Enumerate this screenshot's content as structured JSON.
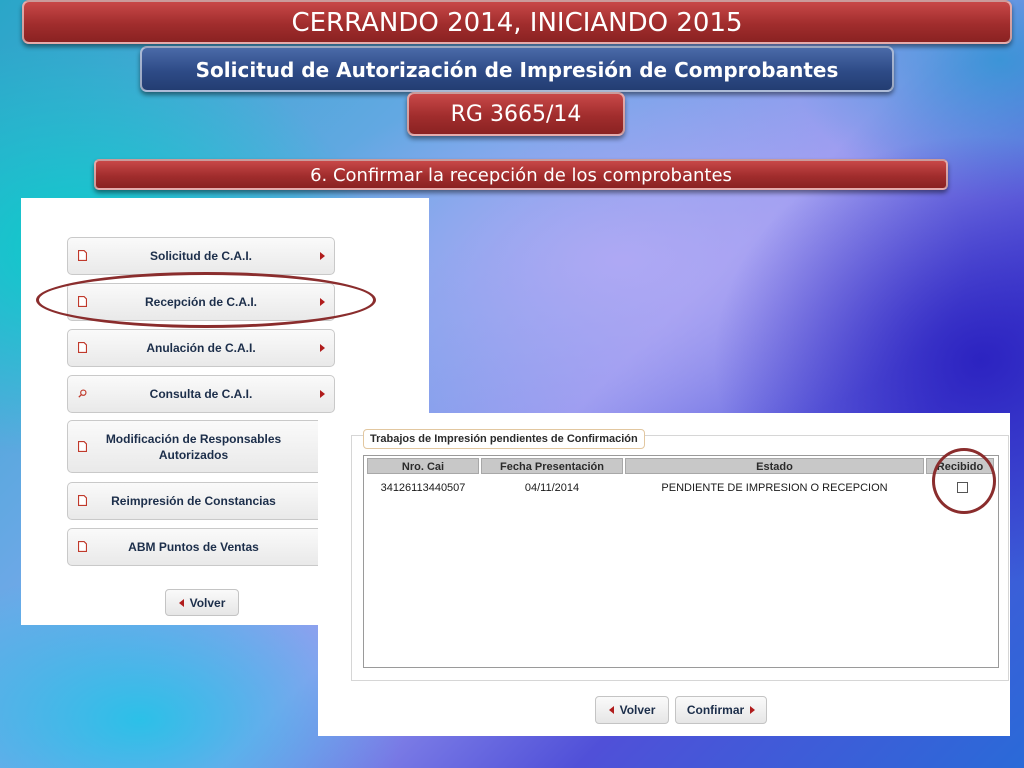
{
  "header": {
    "title": "CERRANDO 2014, INICIANDO 2015",
    "subtitle": "Solicitud de Autorización de Impresión de Comprobantes",
    "resolution": "RG 3665/14",
    "step": "6. Confirmar la recepción de los comprobantes"
  },
  "menu": {
    "items": [
      {
        "label": "Solicitud de C.A.I.",
        "icon": "document-icon"
      },
      {
        "label": "Recepción de C.A.I.",
        "icon": "document-icon"
      },
      {
        "label": "Anulación de C.A.I.",
        "icon": "document-icon"
      },
      {
        "label": "Consulta de C.A.I.",
        "icon": "search-icon"
      },
      {
        "label": "Modificación de Responsables Autorizados",
        "icon": "document-icon"
      },
      {
        "label": "Reimpresión de Constancias",
        "icon": "document-icon"
      },
      {
        "label": "ABM Puntos de Ventas",
        "icon": "document-icon"
      }
    ],
    "back_label": "Volver"
  },
  "jobs": {
    "legend": "Trabajos de Impresión pendientes de Confirmación",
    "columns": [
      "Nro. Cai",
      "Fecha Presentación",
      "Estado",
      "Recibido"
    ],
    "rows": [
      {
        "nro_cai": "34126113440507",
        "fecha": "04/11/2014",
        "estado": "PENDIENTE DE IMPRESION O RECEPCION",
        "recibido": false
      }
    ],
    "back_label": "Volver",
    "confirm_label": "Confirmar"
  },
  "colors": {
    "banner_red": "#a12d2d",
    "banner_blue": "#2e4b87",
    "highlight_ring": "#8a2d2d",
    "arrow_red": "#b01c1c"
  }
}
